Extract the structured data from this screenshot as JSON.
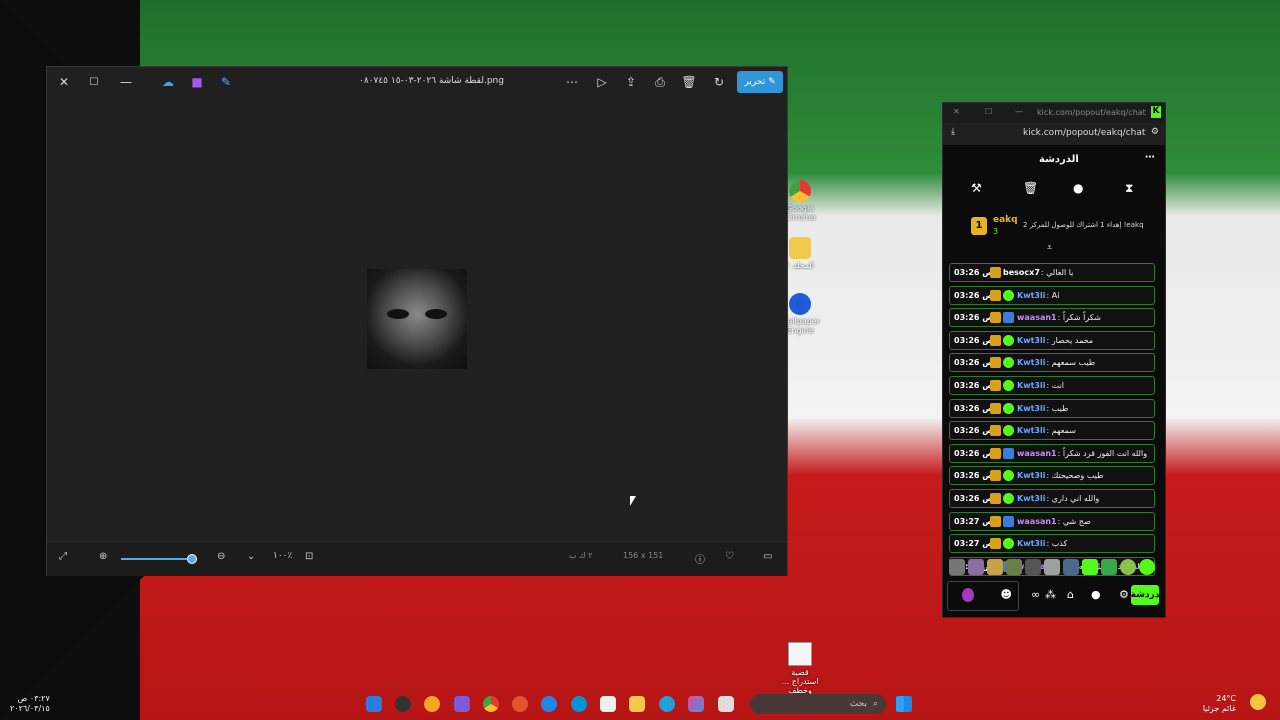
{
  "photos": {
    "file_name": "لقطة شاشة ٢٠٢٦-٠٣-١٥ ٠٨٠٧٤٥.png",
    "edit_label": "تحرير",
    "zoom_level": "١٠٠٪",
    "dimensions": "156 x 151",
    "file_size": "٢ ك ب"
  },
  "chat_window": {
    "title": "kick.com/popout/eakq/chat",
    "url": "kick.com/popout/eakq/chat",
    "header_title": "الدردشة",
    "pinned_user": "eakq",
    "pinned_count": "3",
    "pinned_rank": "1",
    "pinned_text": "إهداء 1 اشتراك للوصول للمركز 2 !eakq",
    "send_label": "دردشة",
    "messages": [
      {
        "time": "03:26 ص",
        "user": "besocx7",
        "text": "يا الغالي",
        "color": "#ffffff"
      },
      {
        "time": "03:26 ص",
        "user": "Kwt3li",
        "text": "Ai",
        "color": "#6aa7ff"
      },
      {
        "time": "03:26 ص",
        "user": "waasan1",
        "text": "شكراً شكراً",
        "color": "#c98bff"
      },
      {
        "time": "03:26 ص",
        "user": "Kwt3li",
        "text": "محمد يحصار",
        "color": "#6aa7ff"
      },
      {
        "time": "03:26 ص",
        "user": "Kwt3li",
        "text": "طيب سمعهم",
        "color": "#6aa7ff"
      },
      {
        "time": "03:26 ص",
        "user": "Kwt3li",
        "text": "انت",
        "color": "#6aa7ff"
      },
      {
        "time": "03:26 ص",
        "user": "Kwt3li",
        "text": "طيب",
        "color": "#6aa7ff"
      },
      {
        "time": "03:26 ص",
        "user": "Kwt3li",
        "text": "سمعهم",
        "color": "#6aa7ff"
      },
      {
        "time": "03:26 ص",
        "user": "waasan1",
        "text": "والله انت الفوز قرد شكراً",
        "color": "#c98bff"
      },
      {
        "time": "03:26 ص",
        "user": "Kwt3li",
        "text": "طيب وصحيحتك",
        "color": "#6aa7ff"
      },
      {
        "time": "03:26 ص",
        "user": "Kwt3li",
        "text": "والله اني داري",
        "color": "#6aa7ff"
      },
      {
        "time": "03:27 ص",
        "user": "waasan1",
        "text": "صح شي",
        "color": "#c98bff"
      },
      {
        "time": "03:27 ص",
        "user": "Kwt3li",
        "text": "كذب",
        "color": "#6aa7ff"
      },
      {
        "time": "03:27 ص",
        "user": "waasan1",
        "text": "صالي تعدي دليل قاله شي",
        "color": "#c98bff"
      }
    ]
  },
  "desktop": {
    "icons": [
      {
        "label": "Google Chrome"
      },
      {
        "label": "المجلد ١"
      },
      {
        "label": "Wallpaper Engine"
      },
      {
        "label": "قضية استدراج ... وخطف"
      }
    ]
  },
  "taskbar": {
    "search_placeholder": "بحث",
    "time": "٠٣:٢٧ ص",
    "date": "٢٠٢٦/٠٣/١٥",
    "weather_temp": "24°C",
    "weather_desc": "غائم جزئيا"
  },
  "colors": {
    "kick_green": "#53fc18",
    "photos_accent": "#2f95d6"
  }
}
